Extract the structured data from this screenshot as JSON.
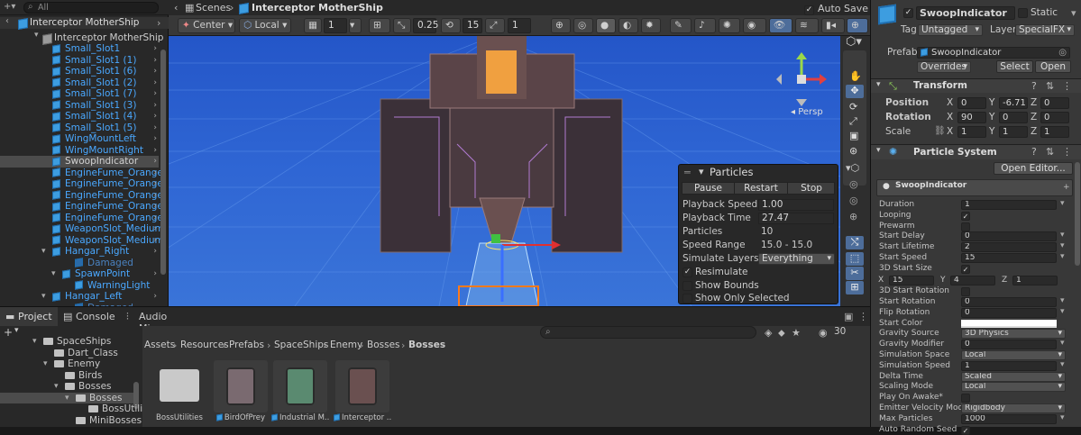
{
  "hierarchy": {
    "search_placeholder": "All",
    "root": "Interceptor MotherShip",
    "child": "Interceptor MotherShip",
    "items": [
      "Small_Slot1",
      "Small_Slot1 (1)",
      "Small_Slot1 (6)",
      "Small_Slot1 (2)",
      "Small_Slot1 (7)",
      "Small_Slot1 (3)",
      "Small_Slot1 (4)",
      "Small_Slot1 (5)",
      "WingMountLeft",
      "WingMountRight",
      "SwoopIndicator",
      "EngineFume_Orange",
      "EngineFume_Orange",
      "EngineFume_Orange",
      "EngineFume_Orange",
      "EngineFume_Orange",
      "WeaponSlot_Medium",
      "WeaponSlot_Medium",
      "Hangar_Right",
      "Damaged",
      "SpawnPoint",
      "WarningLight",
      "Hangar_Left",
      "Damaged"
    ]
  },
  "breadcrumb": {
    "scenes": "Scenes",
    "current": "Interceptor MotherShip",
    "auto_save": "Auto Save"
  },
  "scene_toolbar": {
    "pivot": "Center",
    "space": "Local",
    "grid": "1",
    "snap_move": "0.25",
    "snap_rotate": "15",
    "snap_scale": "1"
  },
  "scene": {
    "persp_label": "Persp"
  },
  "particles_overlay": {
    "title": "Particles",
    "pause": "Pause",
    "restart": "Restart",
    "stop": "Stop",
    "playback_speed_label": "Playback Speed",
    "playback_speed": "1.00",
    "playback_time_label": "Playback Time",
    "playback_time": "27.47",
    "particles_label": "Particles",
    "particles": "10",
    "speed_range_label": "Speed Range",
    "speed_range": "15.0 - 15.0",
    "simulate_layers_label": "Simulate Layers",
    "simulate_layers": "Everything",
    "resimulate": "Resimulate",
    "show_bounds": "Show Bounds",
    "show_only_selected": "Show Only Selected"
  },
  "inspector": {
    "name": "SwoopIndicator",
    "static": "Static",
    "tag_label": "Tag",
    "tag": "Untagged",
    "layer_label": "Layer",
    "layer": "SpecialFX",
    "prefab_label": "Prefab",
    "prefab": "SwoopIndicator",
    "overrides": "Overrides",
    "select": "Select",
    "open": "Open",
    "transform": {
      "title": "Transform",
      "position_label": "Position",
      "px": "0",
      "py": "-6.71",
      "pz": "0",
      "rotation_label": "Rotation",
      "rx": "90",
      "ry": "0",
      "rz": "0",
      "scale_label": "Scale",
      "sx": "1",
      "sy": "1",
      "sz": "1"
    },
    "particle_system": {
      "title": "Particle System",
      "open_editor": "Open Editor...",
      "module_name": "SwoopIndicator",
      "rows": [
        {
          "label": "Duration",
          "value": "1"
        },
        {
          "label": "Looping",
          "value": "✓"
        },
        {
          "label": "Prewarm",
          "value": ""
        },
        {
          "label": "Start Delay",
          "value": "0"
        },
        {
          "label": "Start Lifetime",
          "value": "2"
        },
        {
          "label": "Start Speed",
          "value": "15"
        },
        {
          "label": "3D Start Size",
          "value": "✓"
        }
      ],
      "size_x": "15",
      "size_y": "4",
      "size_z": "1",
      "rows2": [
        {
          "label": "3D Start Rotation",
          "value": ""
        },
        {
          "label": "Start Rotation",
          "value": "0"
        },
        {
          "label": "Flip Rotation",
          "value": "0"
        },
        {
          "label": "Start Color",
          "value": ""
        },
        {
          "label": "Gravity Source",
          "value": "3D Physics"
        },
        {
          "label": "Gravity Modifier",
          "value": "0"
        },
        {
          "label": "Simulation Space",
          "value": "Local"
        },
        {
          "label": "Simulation Speed",
          "value": "1"
        },
        {
          "label": "Delta Time",
          "value": "Scaled"
        },
        {
          "label": "Scaling Mode",
          "value": "Local"
        },
        {
          "label": "Play On Awake*",
          "value": ""
        },
        {
          "label": "Emitter Velocity Mode",
          "value": "Rigidbody"
        },
        {
          "label": "Max Particles",
          "value": "1000"
        },
        {
          "label": "Auto Random Seed",
          "value": "✓"
        }
      ]
    }
  },
  "bottom_tabs": {
    "project": "Project",
    "console": "Console",
    "audio_mixer": "Audio Mixer"
  },
  "project_tree": [
    "SpaceShips",
    "Dart_Class",
    "Enemy",
    "Birds",
    "Bosses",
    "Bosses",
    "BossUtiliti",
    "MiniBosses"
  ],
  "project_breadcrumb": [
    "Assets",
    "Resources",
    "Prefabs",
    "SpaceShips",
    "Enemy",
    "Bosses",
    "Bosses"
  ],
  "assets": [
    "BossUtilities",
    "BirdOfPrey",
    "Industrial M...",
    "Interceptor ..."
  ],
  "icon_count": "30"
}
